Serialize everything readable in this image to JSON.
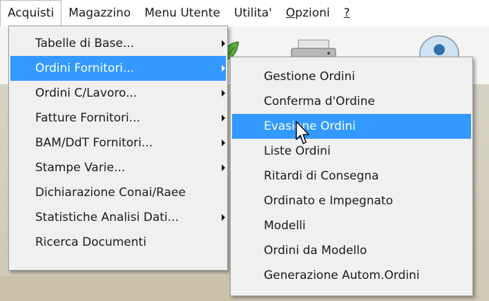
{
  "menubar": {
    "items": [
      {
        "label": "Acquisti",
        "open": true
      },
      {
        "label": "Magazzino"
      },
      {
        "label": "Menu Utente"
      },
      {
        "label": "Utilita'"
      },
      {
        "label_mnemonic": "O",
        "label_rest": "pzioni"
      },
      {
        "label": "?"
      }
    ]
  },
  "acquisti_menu": {
    "items": [
      {
        "label": "Tabelle di Base...",
        "has_submenu": true
      },
      {
        "label": "Ordini Fornitori...",
        "has_submenu": true,
        "selected": true
      },
      {
        "label": "Ordini C/Lavoro...",
        "has_submenu": true
      },
      {
        "label": "Fatture Fornitori...",
        "has_submenu": true
      },
      {
        "label": "BAM/DdT Fornitori...",
        "has_submenu": true
      },
      {
        "label": "Stampe Varie...",
        "has_submenu": true
      },
      {
        "label": "Dichiarazione Conai/Raee"
      },
      {
        "label": "Statistiche Analisi Dati...",
        "has_submenu": true
      },
      {
        "label": "Ricerca Documenti"
      }
    ]
  },
  "ordini_fornitori_submenu": {
    "items": [
      {
        "label": "Gestione Ordini"
      },
      {
        "label": "Conferma d'Ordine"
      },
      {
        "label": "Evasione Ordini",
        "selected": true
      },
      {
        "label": "Liste Ordini"
      },
      {
        "label": "Ritardi di Consegna"
      },
      {
        "label": "Ordinato e Impegnato"
      },
      {
        "label": "Modelli"
      },
      {
        "label": "Ordini da Modello"
      },
      {
        "label": "Generazione Autom.Ordini"
      }
    ]
  },
  "icons": {
    "submenu_arrow": "chevron-right-icon",
    "cursor": "mouse-pointer-icon",
    "toolbar": [
      "leaf-icon",
      "printer-icon",
      "user-icon"
    ]
  },
  "colors": {
    "highlight": "#3399ff",
    "menu_bg": "#f0f0f0",
    "highlight_text": "#ffffff"
  }
}
